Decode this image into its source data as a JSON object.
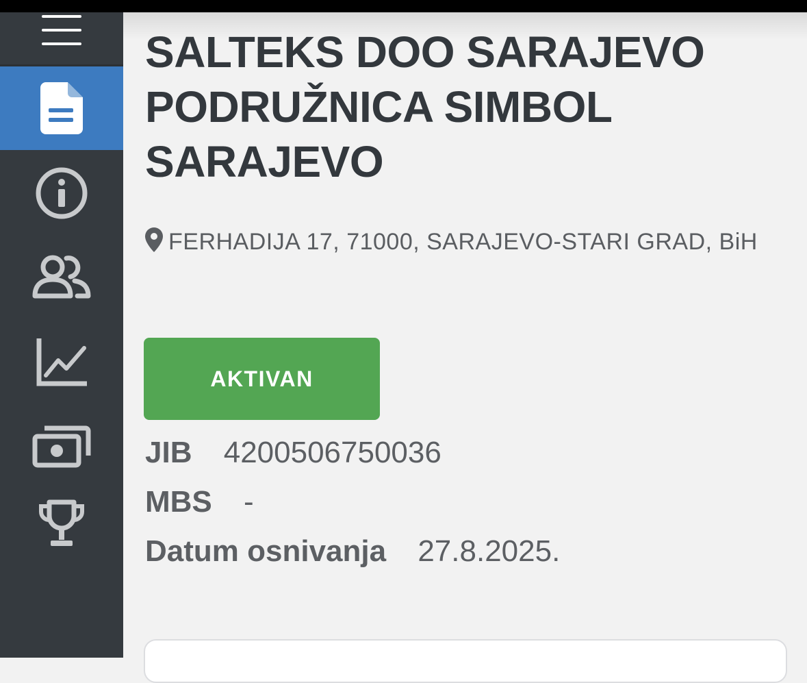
{
  "company": {
    "name": "SALTEKS DOO SARAJEVO PODRUŽNICA SIMBOL SARAJEVO",
    "address": "FERHADIJA 17, 71000, SARAJEVO-STARI GRAD, BiH",
    "status": "AKTIVAN",
    "status_color": "#53a653"
  },
  "details": {
    "jib_label": "JIB",
    "jib_value": "4200506750036",
    "mbs_label": "MBS",
    "mbs_value": "-",
    "founded_label": "Datum osnivanja",
    "founded_value": "27.8.2025."
  },
  "sidebar": {
    "background": "#353a3f",
    "active_color": "#3d7bc0",
    "items": [
      {
        "icon": "document-icon",
        "active": true
      },
      {
        "icon": "info-icon",
        "active": false
      },
      {
        "icon": "people-icon",
        "active": false
      },
      {
        "icon": "chart-line-icon",
        "active": false
      },
      {
        "icon": "money-icon",
        "active": false
      },
      {
        "icon": "trophy-icon",
        "active": false
      }
    ]
  }
}
